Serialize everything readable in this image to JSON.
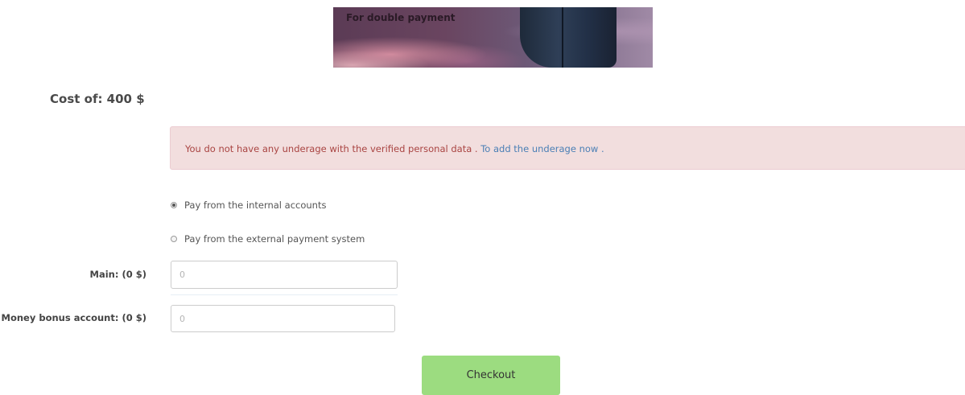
{
  "banner": {
    "text": "For double payment"
  },
  "cost": {
    "text": "Cost of: 400 $"
  },
  "alert": {
    "message": "You do not have any underage with the verified personal data . ",
    "link_text": "To add the underage now",
    "suffix": " ."
  },
  "payment_options": [
    {
      "label": "Pay from the internal accounts",
      "checked": true
    },
    {
      "label": "Pay from the external payment system",
      "checked": false
    }
  ],
  "fields": {
    "main": {
      "label": "Main: (0 $)",
      "placeholder": "0"
    },
    "bonus": {
      "label": "Money bonus account: (0 $)",
      "placeholder": "0"
    }
  },
  "checkout": {
    "label": "Checkout",
    "color": "#9cdc80"
  },
  "colors": {
    "alert_background": "#f2dede",
    "alert_text": "#a94442",
    "link": "#4a7fb5"
  }
}
